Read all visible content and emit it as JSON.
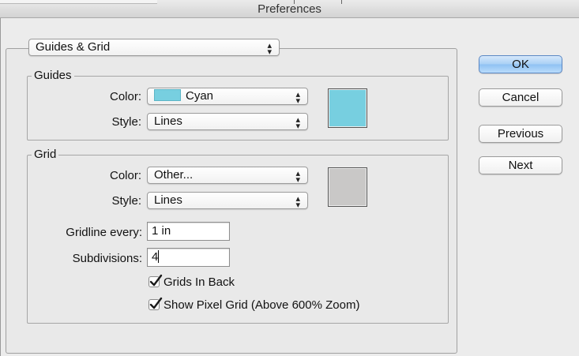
{
  "window": {
    "title": "Preferences"
  },
  "section_select": {
    "value": "Guides & Grid"
  },
  "guides": {
    "legend": "Guides",
    "color_label": "Color:",
    "color_value": "Cyan",
    "color_hex": "#77cfe0",
    "style_label": "Style:",
    "style_value": "Lines"
  },
  "grid": {
    "legend": "Grid",
    "color_label": "Color:",
    "color_value": "Other...",
    "color_hex": "#c9c8c7",
    "style_label": "Style:",
    "style_value": "Lines",
    "gridline_label": "Gridline every:",
    "gridline_value": "1 in",
    "subdivisions_label": "Subdivisions:",
    "subdivisions_value": "4",
    "grids_in_back_label": "Grids In Back",
    "grids_in_back_checked": true,
    "pixel_grid_label": "Show Pixel Grid (Above 600% Zoom)",
    "pixel_grid_checked": true
  },
  "buttons": {
    "ok": "OK",
    "cancel": "Cancel",
    "previous": "Previous",
    "next": "Next"
  }
}
